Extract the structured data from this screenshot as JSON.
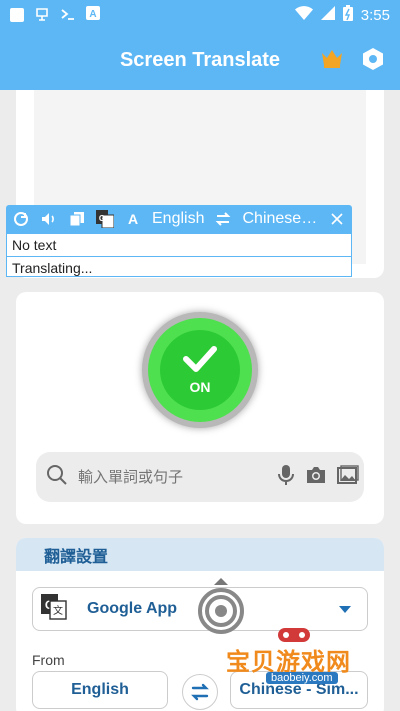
{
  "status_bar": {
    "time": "3:55",
    "icon_names": [
      "square-icon",
      "app-notif-icon",
      "terminal-icon",
      "a-icon",
      "wifi-icon",
      "signal-icon",
      "battery-icon"
    ]
  },
  "app_bar": {
    "title": "Screen Translate"
  },
  "floating_bar": {
    "source_lang": "English",
    "target_lang": "Chinese…",
    "line1": "No text",
    "line2": "Translating...",
    "a_label": "A"
  },
  "power": {
    "label": "ON"
  },
  "search": {
    "placeholder": "輸入單詞或句子"
  },
  "settings": {
    "header": "翻譯設置",
    "engine": "Google App",
    "from_label": "From",
    "from_lang": "English",
    "to_lang": "Chinese - Sim..."
  },
  "watermark": {
    "text": "宝贝游戏网",
    "url": "baobeiy.com"
  },
  "colors": {
    "primary": "#5db7f5",
    "accent_dark": "#1f5f96",
    "power_green": "#2cca34",
    "crown": "#f2a524"
  }
}
